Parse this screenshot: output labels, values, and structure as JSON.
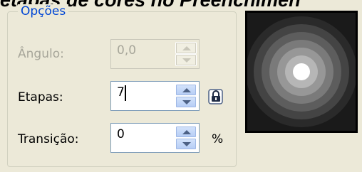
{
  "heading": "etapas de cores no Preenchimen",
  "options_group": {
    "legend": "Opções",
    "angle": {
      "label": "Ângulo:",
      "value": "0,0"
    },
    "steps": {
      "label": "Etapas:",
      "value": "7"
    },
    "transition": {
      "label": "Transição:",
      "value": "0",
      "unit": "%"
    }
  },
  "icons": {
    "spin_up": "spin-up-arrow-icon",
    "spin_down": "spin-down-arrow-icon",
    "lock": "lock-icon"
  },
  "preview": {
    "steps": 7,
    "colors": [
      "#2a2a2a",
      "#444444",
      "#5d5d5d",
      "#7a7a7a",
      "#979797",
      "#b6b6b6",
      "#ffffff"
    ]
  }
}
